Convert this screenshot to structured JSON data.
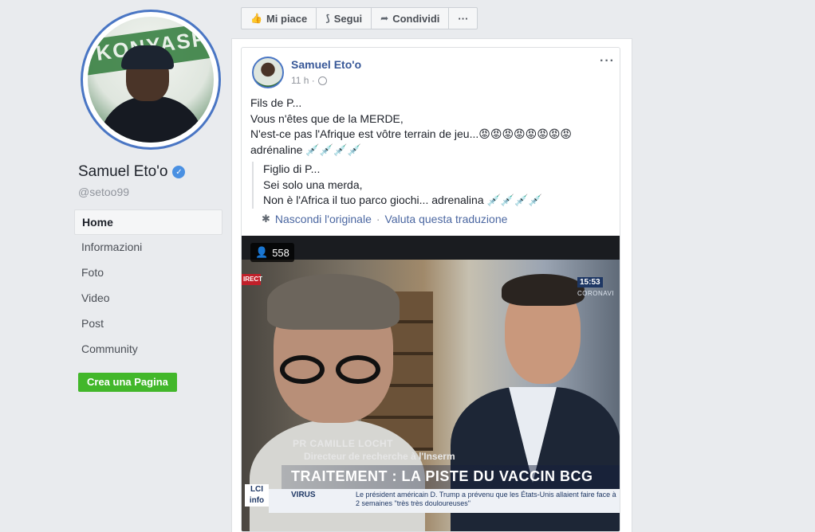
{
  "page": {
    "name": "Samuel Eto'o",
    "handle": "@setoo99",
    "profile_banner_text": "KONYASPOR"
  },
  "nav": {
    "items": [
      {
        "label": "Home",
        "active": true
      },
      {
        "label": "Informazioni"
      },
      {
        "label": "Foto"
      },
      {
        "label": "Video"
      },
      {
        "label": "Post"
      },
      {
        "label": "Community"
      }
    ],
    "create_page_label": "Crea una Pagina"
  },
  "toolbar": {
    "like_label": "Mi piace",
    "follow_label": "Segui",
    "share_label": "Condividi",
    "more_label": "···"
  },
  "post": {
    "author": "Samuel Eto'o",
    "time": "11 h ·",
    "lines": [
      "Fils de P...",
      "Vous n'êtes que de la MERDE,",
      "N'est-ce pas l'Afrique est vôtre terrain de jeu...😡😡😡😡😡😡😡😡",
      "adrénaline 💉💉💉💉"
    ],
    "translation_lines": [
      "Figlio di P...",
      "Sei solo una merda,",
      "Non è l'Africa il tuo parco giochi... adrenalina 💉💉💉💉"
    ],
    "hide_original": "Nascondi l'originale",
    "rate_translation": "Valuta questa traduzione",
    "separator": "·"
  },
  "video": {
    "viewers": "558",
    "live_tag": "IRECT",
    "clock": "15:53",
    "clock_sub": "CORONAVI",
    "lower_third": {
      "name": "PR CAMILLE LOCHT",
      "role": "Directeur de recherche à l'Inserm",
      "headline": "TRAITEMENT : LA PISTE DU VACCIN BCG",
      "channel": "LCI info",
      "ticker_label": "VIRUS",
      "ticker_text": "Le président américain D. Trump a prévenu que les États-Unis allaient faire face à 2 semaines \"très très douloureuses\""
    }
  },
  "colors": {
    "background": "#e9ebee",
    "link": "#385898",
    "green_button": "#42b72a",
    "profile_ring": "#4a76c4"
  }
}
